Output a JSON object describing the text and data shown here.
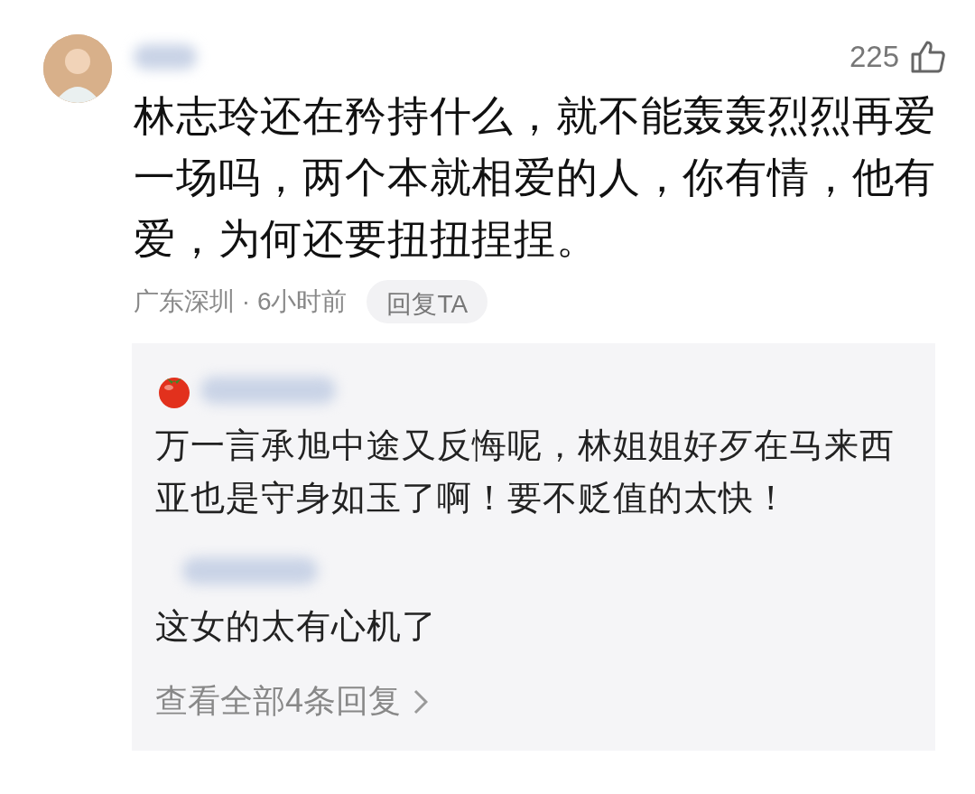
{
  "comment": {
    "likes": "225",
    "text": "林志玲还在矜持什么，就不能轰轰烈烈再爱一场吗，两个本就相爱的人，你有情，他有爱，为何还要扭扭捏捏。",
    "meta": "广东深圳 · 6小时前",
    "reply_button": "回复TA"
  },
  "replies": [
    {
      "kind": "with-icon",
      "text": "万一言承旭中途又反悔呢，林姐姐好歹在马来西亚也是守身如玉了啊！要不贬值的太快！"
    },
    {
      "kind": "plain",
      "text": "这女的太有心机了"
    }
  ],
  "more_replies": "查看全部4条回复"
}
